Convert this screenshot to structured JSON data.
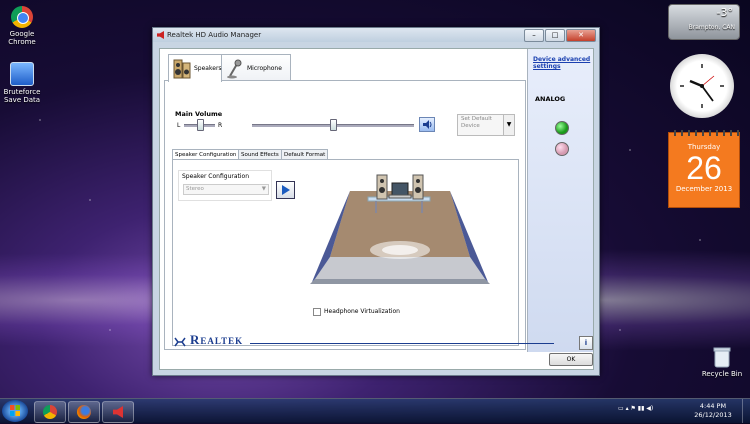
{
  "desktop": {
    "icons": [
      {
        "label_line1": "Google",
        "label_line2": "Chrome"
      },
      {
        "label_line1": "Bruteforce",
        "label_line2": "Save Data"
      }
    ],
    "recycle_bin": "Recycle Bin"
  },
  "weather": {
    "temp": "-3°",
    "location": "Brampton, CAN"
  },
  "calendar": {
    "weekday": "Thursday",
    "day": "26",
    "month_year": "December 2013"
  },
  "window": {
    "title": "Realtek HD Audio Manager",
    "min_label": "–",
    "max_label": "□",
    "close_label": "✕",
    "tabs": [
      {
        "label": "Speakers"
      },
      {
        "label": "Microphone"
      }
    ],
    "main_volume": {
      "label": "Main Volume",
      "left": "L",
      "right": "R",
      "balance_level": 0.5,
      "volume_level": 0.5
    },
    "set_default": {
      "label": "Set Default Device",
      "arrow": "▼"
    },
    "subtabs": [
      {
        "label": "Speaker Configuration"
      },
      {
        "label": "Sound Effects"
      },
      {
        "label": "Default Format"
      }
    ],
    "speaker_config": {
      "label": "Speaker Configuration",
      "value": "Stereo",
      "arrow": "▼"
    },
    "headphone_virtualization": "Headphone Virtualization",
    "right_panel": {
      "link": "Device advanced settings",
      "analog": "ANALOG",
      "jack_colors": [
        "#1a9a1a",
        "#d59ab0"
      ]
    },
    "brand": "Realtek",
    "info_label": "i",
    "ok_label": "OK"
  },
  "taskbar": {
    "time": "4:44 PM",
    "date": "26/12/2013"
  }
}
